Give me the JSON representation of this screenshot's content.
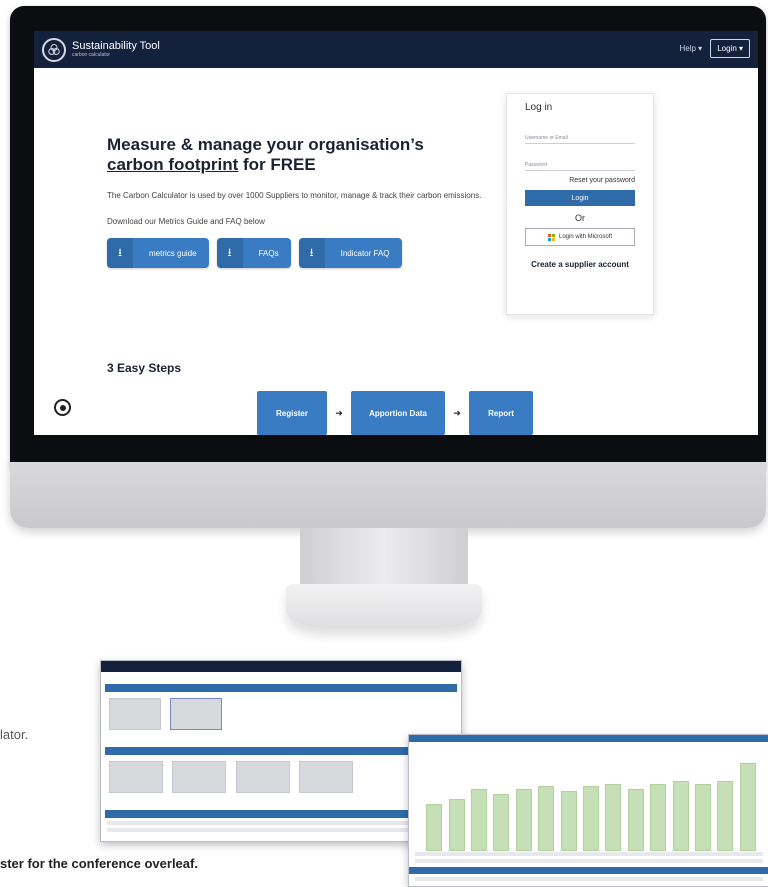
{
  "navbar": {
    "brand_name": "Sustainability Tool",
    "brand_subtitle": "carbon calculator",
    "help_label": "Help ▾",
    "login_label": "Login ▾"
  },
  "hero": {
    "title_line1": "Measure & manage your organisation’s",
    "title_underlined": "carbon footprint",
    "title_suffix": " for FREE",
    "description": "The Carbon Calculator is used by over 1000 Suppliers to monitor, manage & track their carbon emissions.",
    "download_text": "Download our Metrics Guide and FAQ below",
    "buttons": [
      {
        "label": "metrics guide",
        "icon": "download-icon"
      },
      {
        "label": "FAQs",
        "icon": "download-icon"
      },
      {
        "label": "Indicator FAQ",
        "icon": "download-icon"
      }
    ]
  },
  "login": {
    "title": "Log in",
    "username_placeholder": "Username or Email",
    "password_placeholder": "Password",
    "reset_link": "Reset your password",
    "login_button": "Login",
    "or_text": "Or",
    "microsoft_button": "Login with Microsoft",
    "create_account": "Create a supplier account"
  },
  "steps": {
    "title": "3 Easy Steps",
    "items": [
      "Register",
      "Apportion Data",
      "Report"
    ],
    "arrow": "➜"
  },
  "page_text": {
    "fragment_1": "lator.",
    "fragment_2": "ster for the conference overleaf."
  },
  "colors": {
    "navbar": "#14213d",
    "primary_button": "#3a7cc3",
    "chart_bar": "#c7dfb6"
  },
  "chart_data": {
    "type": "bar",
    "values": [
      18,
      20,
      24,
      22,
      24,
      25,
      23,
      25,
      26,
      24,
      26,
      27,
      26,
      27,
      34
    ]
  }
}
